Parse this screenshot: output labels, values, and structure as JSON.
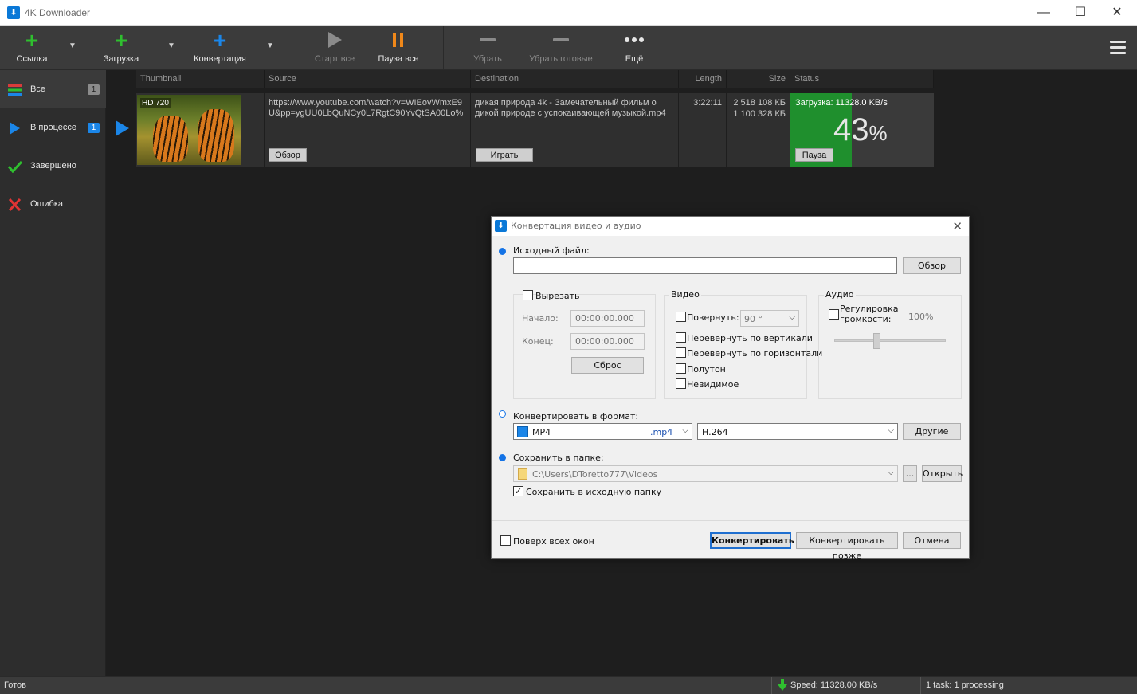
{
  "window": {
    "title": "4K Downloader",
    "minimize": "—",
    "maximize": "☐",
    "close": "✕"
  },
  "toolbar": {
    "link": "Ссылка",
    "download": "Загрузка",
    "convert": "Конвертация",
    "start_all": "Старт все",
    "pause_all": "Пауза все",
    "remove": "Убрать",
    "remove_done": "Убрать готовые",
    "more": "Ещё"
  },
  "sidebar": {
    "items": [
      {
        "label": "Все",
        "badge": "1"
      },
      {
        "label": "В процессе",
        "badge": "1"
      },
      {
        "label": "Завершено"
      },
      {
        "label": "Ошибка"
      }
    ]
  },
  "columns": [
    "Thumbnail",
    "Source",
    "Destination",
    "Length",
    "Size",
    "Status"
  ],
  "download": {
    "quality": "HD 720",
    "source_url": "https://www.youtube.com/watch?v=WIEovWmxE9U&pp=ygUU0LbQuNCy0L7RgtC90YvQtSA00Lo%3D",
    "source_btn": "Обзор",
    "destination": "дикая природа 4k - Замечательный фильм о дикой природе с успокаивающей музыкой.mp4",
    "destination_btn": "Играть",
    "length": "3:22:11",
    "size_total": "2 518 108 КБ",
    "size_done": "1 100 328 КБ",
    "status_text": "Загрузка: 11328.0 KB/s",
    "progress_value": "43",
    "progress_unit": "%",
    "progress_fraction": 0.43,
    "status_btn": "Пауза"
  },
  "statusbar": {
    "ready": "Готов",
    "speed": "Speed: 11328.00 KB/s",
    "tasks": "1 task: 1 processing"
  },
  "dialog": {
    "title": "Конвертация видео и аудио",
    "close": "✕",
    "source_label": "Исходный файл:",
    "source_value": "",
    "browse_btn": "Обзор",
    "cut_label": "Вырезать",
    "start_label": "Начало:",
    "start_value": "00:00:00.000",
    "end_label": "Конец:",
    "end_value": "00:00:00.000",
    "reset_btn": "Сброс",
    "video_group": "Видео",
    "rotate_label": "Повернуть:",
    "rotate_value": "90 °",
    "flip_v": "Перевернуть по вертикали",
    "flip_h": "Перевернуть по горизонтали",
    "halftone": "Полутон",
    "invisible": "Невидимое",
    "audio_group": "Аудио",
    "volume_label_1": "Регулировка",
    "volume_label_2": "громкости:",
    "volume_value": "100%",
    "volume_fraction": 0.35,
    "format_label": "Конвертировать в формат:",
    "format_name": "MP4",
    "format_ext": ".mp4",
    "codec": "H.264",
    "other_btn": "Другие",
    "save_label": "Сохранить в папке:",
    "save_path": "C:\\Users\\DToretto777\\Videos",
    "dots_btn": "...",
    "open_btn": "Открыть",
    "save_src_label": "Сохранить в исходную папку",
    "on_top_label": "Поверх всех окон",
    "convert_btn": "Конвертировать",
    "convert_later_btn": "Конвертировать позже",
    "cancel_btn": "Отмена"
  },
  "colors": {
    "accent": "#1b86e8",
    "progress": "#1f8f2d",
    "add": "#2fbf2f",
    "pause": "#f0881a"
  }
}
